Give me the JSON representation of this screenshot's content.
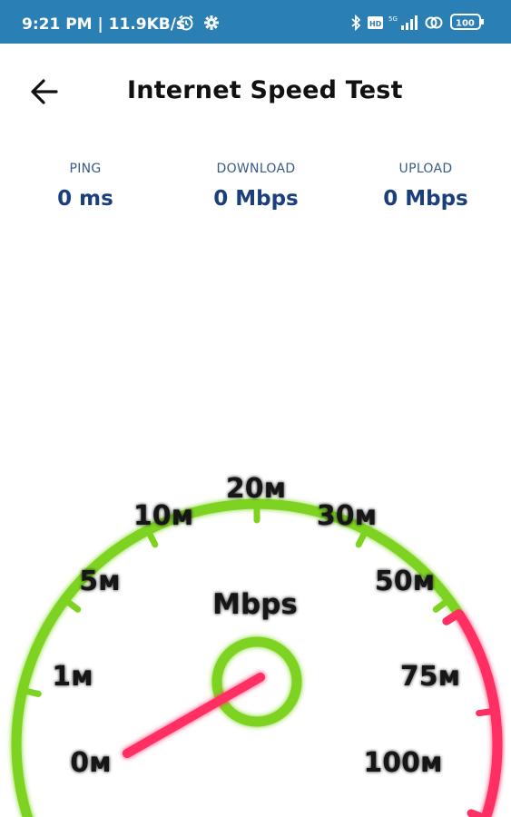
{
  "status_bar": {
    "time_speed": "9:21 PM | 11.9KB/s",
    "battery": "100",
    "icons": [
      "alarm-icon",
      "settings-icon",
      "bluetooth-icon",
      "volte-icon",
      "signal-5g-icon",
      "hotspot-icon",
      "battery-icon"
    ]
  },
  "header": {
    "title": "Internet Speed Test",
    "back_icon": "arrow-left-icon"
  },
  "stats": {
    "ping": {
      "label": "PING",
      "value": "0 ms"
    },
    "download": {
      "label": "DOWNLOAD",
      "value": "0 Mbps"
    },
    "upload": {
      "label": "UPLOAD",
      "value": "0 Mbps"
    }
  },
  "gauge": {
    "unit": "Mbps",
    "current_value_mbps": 0,
    "ticks": [
      "0м",
      "1м",
      "5м",
      "10м",
      "20м",
      "30м",
      "50м",
      "75м",
      "100м"
    ],
    "colors": {
      "normal": "#7ed321",
      "high": "#ff2e63",
      "needle": "#ff2e63"
    }
  }
}
